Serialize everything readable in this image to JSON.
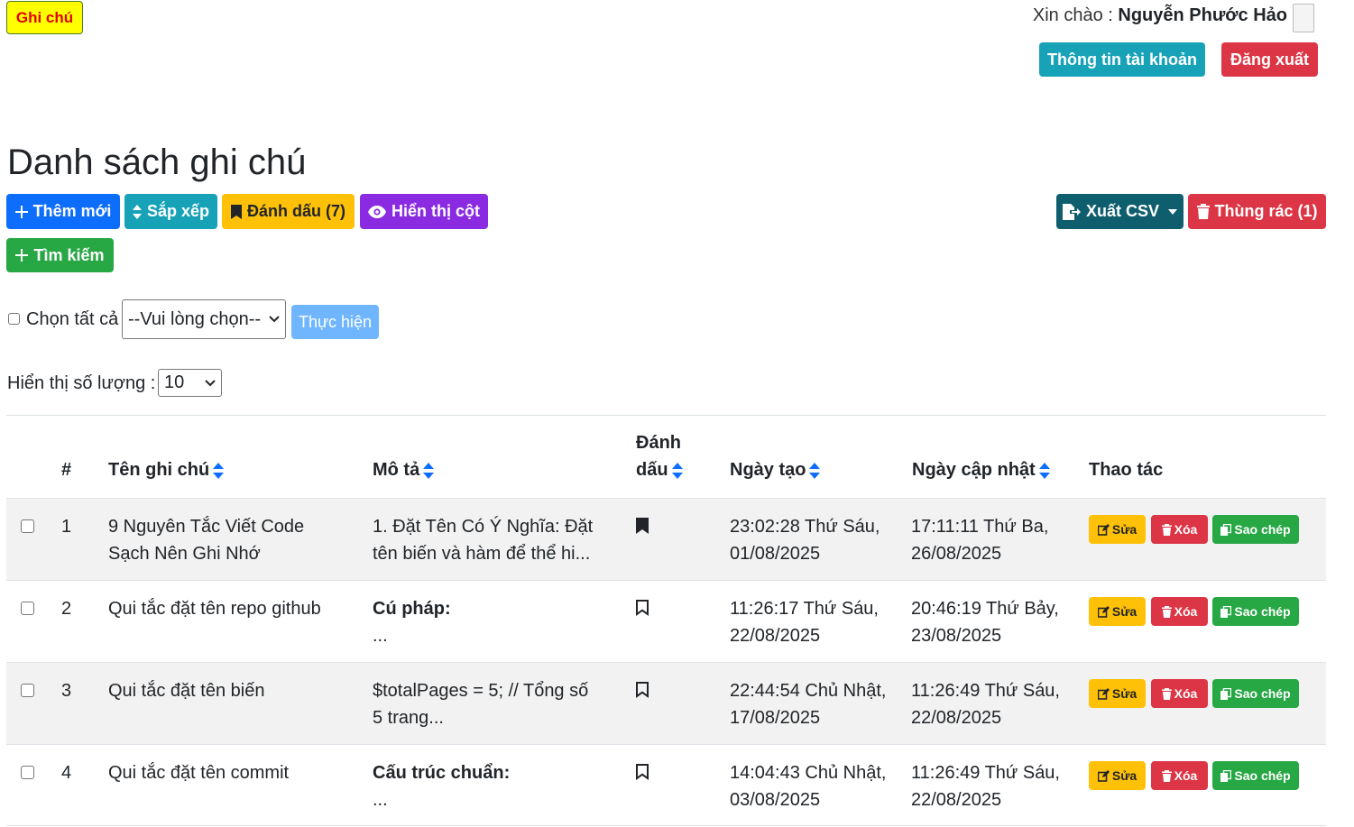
{
  "header": {
    "logo_label": "Ghi chú",
    "greeting_prefix": "Xin chào : ",
    "user_name": "Nguyễn Phước Hảo",
    "account_button": "Thông tin tài khoản",
    "logout_button": "Đăng xuất"
  },
  "page": {
    "title": "Danh sách ghi chú"
  },
  "toolbar": {
    "add_button": "Thêm mới",
    "sort_button": "Sắp xếp",
    "bookmark_button": "Đánh dấu (7)",
    "columns_button": "Hiển thị cột",
    "export_button": "Xuất CSV",
    "trash_button": "Thùng rác (1)",
    "search_button": "Tìm kiếm"
  },
  "bulk": {
    "select_all_label": "Chọn tất cả",
    "action_select_value": "--Vui lòng chọn--",
    "execute_button": "Thực hiện"
  },
  "page_size": {
    "label": "Hiển thị số lượng :",
    "value": "10"
  },
  "table": {
    "headers": {
      "index": "#",
      "name": "Tên ghi chú",
      "description": "Mô tả",
      "bookmark_line1": "Đánh",
      "bookmark_line2": "dấu",
      "created": "Ngày tạo",
      "updated": "Ngày cập nhật",
      "actions": "Thao tác"
    },
    "action_labels": {
      "edit": "Sửa",
      "delete": "Xóa",
      "copy": "Sao chép"
    },
    "rows": [
      {
        "index": "1",
        "name_line1": "9 Nguyên Tắc Viết Code",
        "name_line2": "Sạch Nên Ghi Nhớ",
        "desc_line1": "1. Đặt Tên Có Ý Nghĩa: Đặt",
        "desc_line2": "tên biến và hàm để thể hi...",
        "bookmarked": true,
        "created_line1": "23:02:28 Thứ Sáu,",
        "created_line2": "01/08/2025",
        "updated_line1": "17:11:11 Thứ Ba,",
        "updated_line2": "26/08/2025"
      },
      {
        "index": "2",
        "name_line1": "Qui tắc đặt tên repo github",
        "name_line2": "",
        "desc_line1": "Cú pháp:",
        "desc_line2": "...",
        "bookmarked": false,
        "created_line1": "11:26:17 Thứ Sáu,",
        "created_line2": "22/08/2025",
        "updated_line1": "20:46:19 Thứ Bảy,",
        "updated_line2": "23/08/2025"
      },
      {
        "index": "3",
        "name_line1": "Qui tắc đặt tên biến",
        "name_line2": "",
        "desc_line1": "$totalPages = 5; // Tổng số",
        "desc_line2": "5 trang...",
        "bookmarked": false,
        "created_line1": "22:44:54 Chủ Nhật,",
        "created_line2": "17/08/2025",
        "updated_line1": "11:26:49 Thứ Sáu,",
        "updated_line2": "22/08/2025"
      },
      {
        "index": "4",
        "name_line1": "Qui tắc đặt tên commit",
        "name_line2": "",
        "desc_line1": "Cấu trúc chuẩn:",
        "desc_line2": "...",
        "bookmarked": false,
        "created_line1": "14:04:43 Chủ Nhật,",
        "created_line2": "03/08/2025",
        "updated_line1": "11:26:49 Thứ Sáu,",
        "updated_line2": "22/08/2025"
      }
    ]
  },
  "colors": {
    "primary": "#0d6efd",
    "info": "#17a2b8",
    "warning": "#ffc107",
    "purple": "#8a2be2",
    "export": "#0f5e6e",
    "danger": "#dc3545",
    "success": "#28a745",
    "execute_disabled": "#6fb6ff"
  },
  "icons": [
    "plus-icon",
    "sort-icon",
    "bookmark-icon",
    "eye-icon",
    "file-export-icon",
    "trash-icon",
    "edit-icon",
    "copy-icon",
    "caret-down-icon",
    "chevron-down-icon"
  ]
}
